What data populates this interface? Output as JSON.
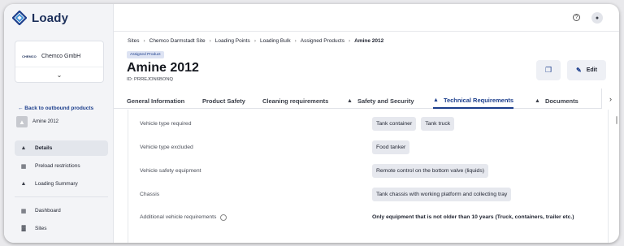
{
  "app": {
    "brand": "Loady"
  },
  "sidebar": {
    "company": {
      "logo_text": "CHEMCO",
      "name": "Chemco GmbH"
    },
    "back_link": "← Back to outbound products",
    "product": "Amine 2012",
    "nav_top": [
      {
        "label": "Details",
        "icon": "flask-icon"
      },
      {
        "label": "Preload restrictions",
        "icon": "document-icon"
      },
      {
        "label": "Loading Summary",
        "icon": "flask-icon"
      }
    ],
    "nav_bottom": [
      {
        "label": "Dashboard",
        "icon": "dashboard-icon"
      },
      {
        "label": "Sites",
        "icon": "sites-icon"
      }
    ]
  },
  "breadcrumb": [
    "Sites",
    "Chemco Darmstadt Site",
    "Loading Points",
    "Loading Bulk",
    "Assigned Products",
    "Amine 2012"
  ],
  "header": {
    "badge": "Assigned Product",
    "title": "Amine 2012",
    "id": "ID: PRREJON6BONQ",
    "edit_label": "Edit"
  },
  "tabs": [
    {
      "label": "General Information",
      "icon": ""
    },
    {
      "label": "Product Safety",
      "icon": ""
    },
    {
      "label": "Cleaning requirements",
      "icon": ""
    },
    {
      "label": "Safety and Security",
      "icon": "flask-icon"
    },
    {
      "label": "Technical Requirements",
      "icon": "flask-icon",
      "active": true
    },
    {
      "label": "Documents",
      "icon": "flask-icon"
    }
  ],
  "requirements": [
    {
      "label": "Vehicle type required",
      "chips": [
        "Tank container",
        "Tank truck"
      ]
    },
    {
      "label": "Vehicle type excluded",
      "chips": [
        "Food tanker"
      ]
    },
    {
      "label": "Vehicle safety equipment",
      "chips": [
        "Remote control on the bottom valve (liquids)"
      ]
    },
    {
      "label": "Chassis",
      "chips": [
        "Tank chassis with working platform and collecting tray"
      ]
    },
    {
      "label": "Additional vehicle requirements",
      "value": "Only equipment that is not older than 10 years (Truck, containers, trailer etc.)"
    }
  ],
  "colors": {
    "accent": "#1c3e8c",
    "chip": "#e6e8ee",
    "sidebar": "#f3f4f7"
  }
}
